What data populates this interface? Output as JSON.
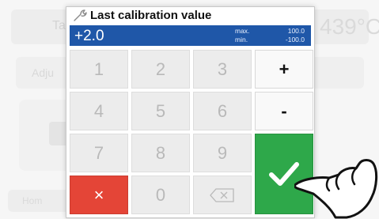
{
  "background": {
    "tab_label": "Ta",
    "temperature": "439°C",
    "adjust_label": "Adju",
    "home_label": "Hom"
  },
  "dialog": {
    "title": "Last calibration value",
    "value": "+2.0",
    "max_label": "max.",
    "max_value": "100.0",
    "min_label": "min.",
    "min_value": "-100.0"
  },
  "keypad": {
    "k1": "1",
    "k2": "2",
    "k3": "3",
    "k4": "4",
    "k5": "5",
    "k6": "6",
    "k7": "7",
    "k8": "8",
    "k9": "9",
    "k0": "0",
    "plus": "+",
    "minus": "-",
    "cancel": "×"
  },
  "colors": {
    "value_bar": "#1f57a8",
    "cancel": "#e44537",
    "ok": "#2ea84a"
  }
}
